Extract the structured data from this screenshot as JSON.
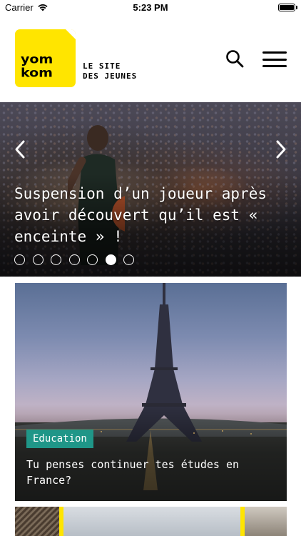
{
  "status_bar": {
    "carrier": "Carrier",
    "time": "5:23 PM",
    "battery_level": 1.0
  },
  "header": {
    "logo": {
      "line1": "yom",
      "line2": "kom",
      "brand_color": "#ffe500"
    },
    "tagline_line1": "LE SITE",
    "tagline_line2": "DES JEUNES",
    "search_icon": "search-icon",
    "menu_icon": "hamburger-menu-icon"
  },
  "hero_slider": {
    "title": "Suspension d’un joueur après avoir découvert qu’il est « enceinte » !",
    "prev_icon": "chevron-left-icon",
    "next_icon": "chevron-right-icon",
    "total_slides": 7,
    "active_slide": 6
  },
  "articles": [
    {
      "category": "Education",
      "category_color": "#1f9688",
      "title": "Tu penses continuer tes études en France?"
    }
  ]
}
